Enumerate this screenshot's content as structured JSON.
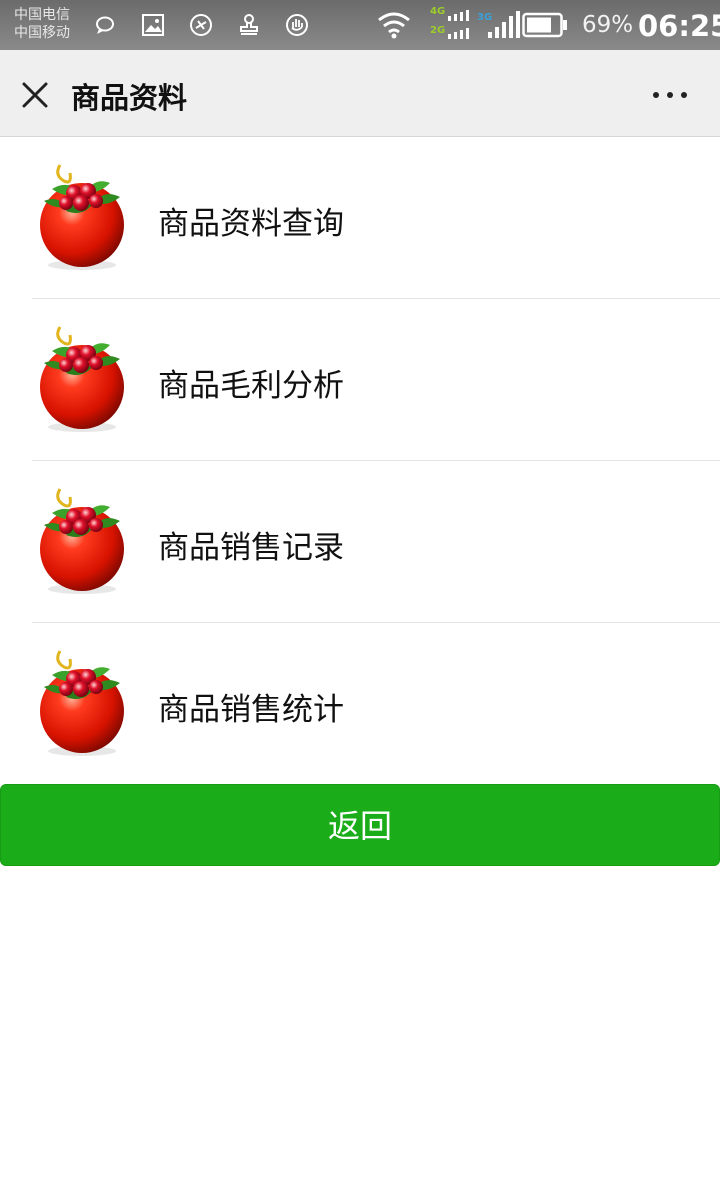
{
  "status_bar": {
    "carrier_1": "中国电信",
    "carrier_2": "中国移动",
    "net_4g": "4G",
    "net_2g": "2G",
    "net_3g": "3G",
    "battery_percent": "69%",
    "time": "06:25",
    "icons": [
      "chat-bubble-icon",
      "image-icon",
      "maps-icon",
      "stamp-icon",
      "hand-icon",
      "wifi-icon",
      "signal-icon",
      "battery-icon"
    ]
  },
  "nav": {
    "title": "商品资料",
    "close_icon": "close-icon",
    "more_icon": "more-dots-icon"
  },
  "menu": {
    "items": [
      {
        "label": "商品资料查询",
        "icon": "ornament-icon"
      },
      {
        "label": "商品毛利分析",
        "icon": "ornament-icon"
      },
      {
        "label": "商品销售记录",
        "icon": "ornament-icon"
      },
      {
        "label": "商品销售统计",
        "icon": "ornament-icon"
      }
    ]
  },
  "back_button": {
    "label": "返回",
    "color": "#1aad19"
  },
  "colors": {
    "nav_bg": "#efeff0",
    "status_bg": "#7a7a7a",
    "accent": "#1aad19"
  }
}
